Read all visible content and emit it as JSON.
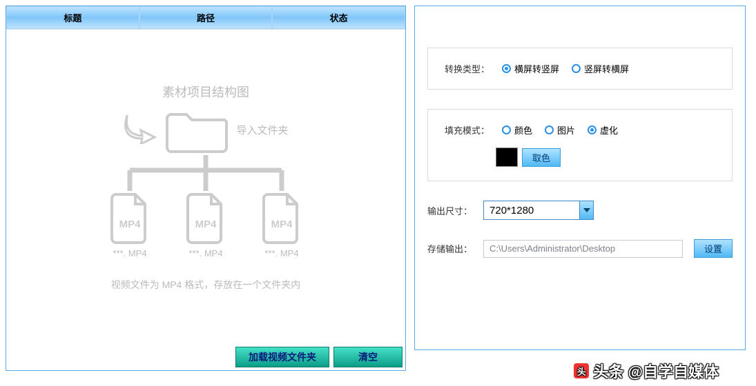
{
  "columns": {
    "title": "标题",
    "path": "路径",
    "status": "状态"
  },
  "diagram": {
    "heading": "素材项目结构图",
    "importLabel": "导入文件夹",
    "fileType": "MP4",
    "fileCaption": "***. MP4",
    "hint": "视频文件为 MP4 格式，存放在一个文件夹内"
  },
  "buttons": {
    "loadFolder": "加载视频文件夹",
    "clear": "清空",
    "pickColor": "取色",
    "setting": "设置"
  },
  "convert": {
    "label": "转换类型：",
    "opt1": "横屏转竖屏",
    "opt2": "竖屏转横屏"
  },
  "fill": {
    "label": "填充模式：",
    "opt1": "颜色",
    "opt2": "图片",
    "opt3": "虚化"
  },
  "output": {
    "sizeLabel": "输出尺寸：",
    "sizeValue": "720*1280",
    "pathLabel": "存储输出：",
    "pathValue": "C:\\Users\\Administrator\\Desktop"
  },
  "watermark": "头条 @自学自媒体"
}
